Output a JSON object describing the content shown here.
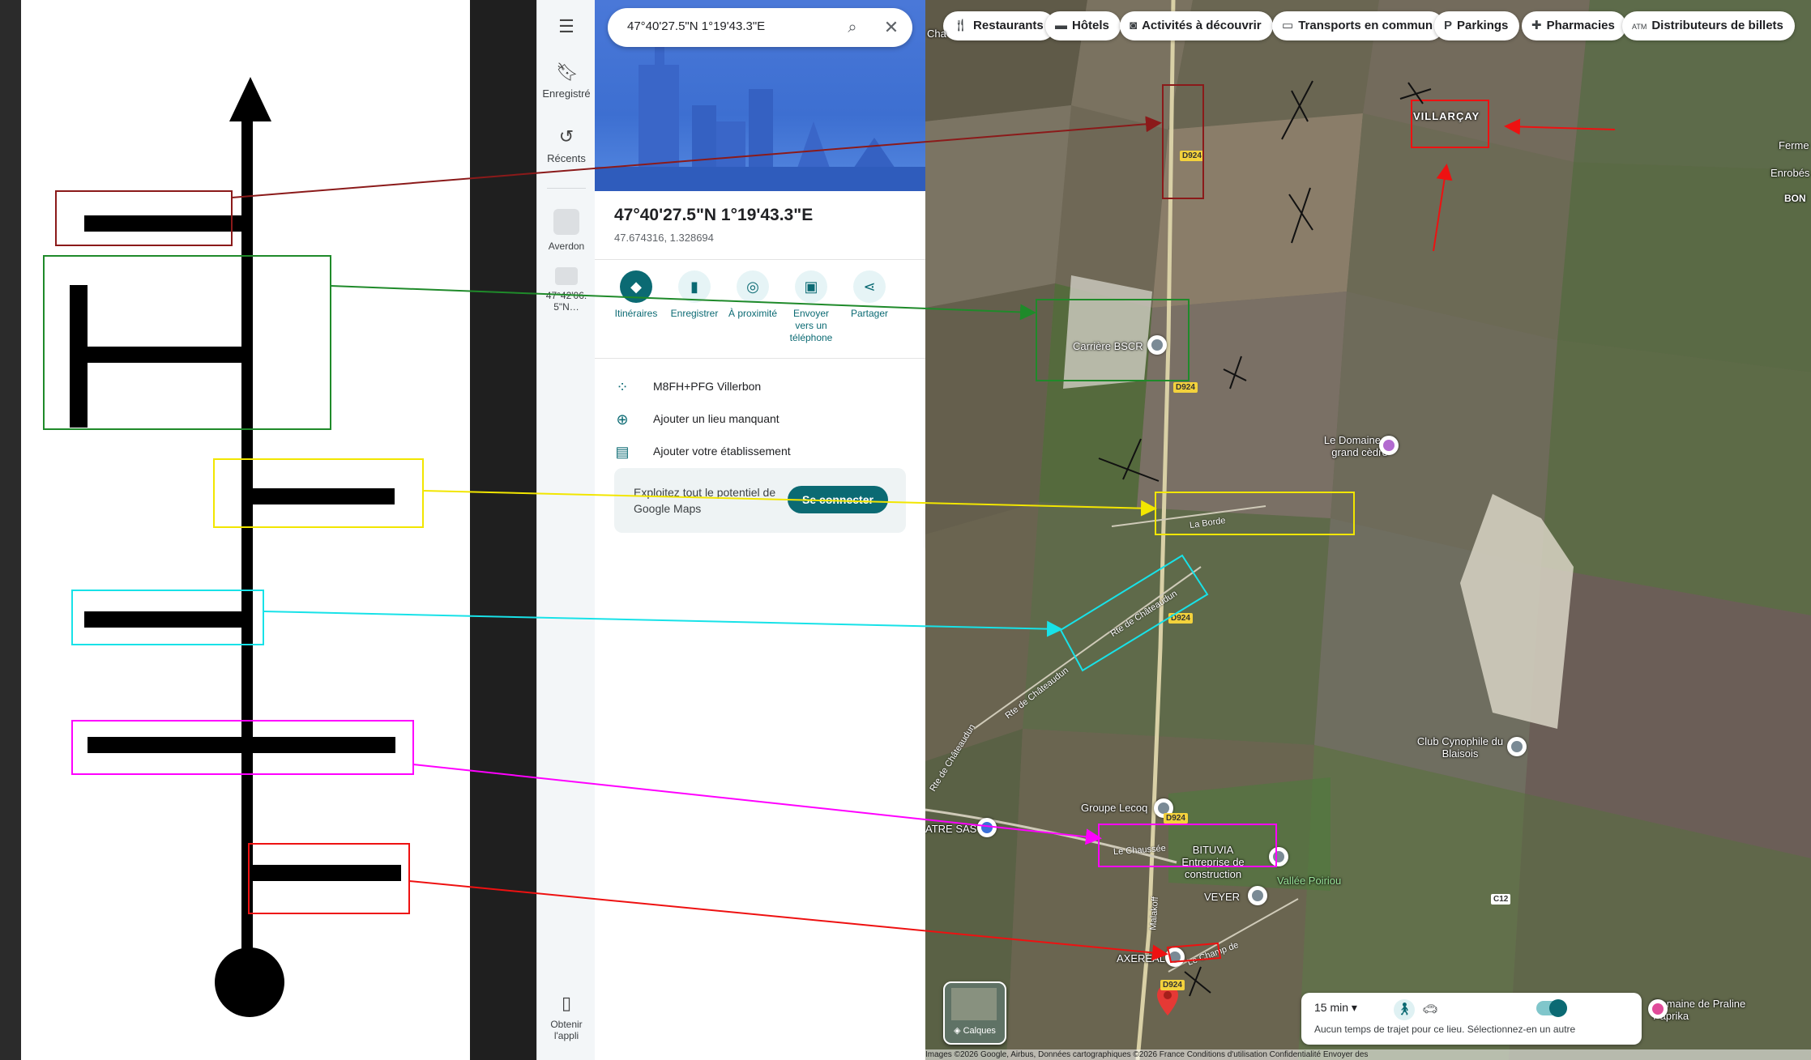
{
  "colors": {
    "maroon": "#8b1a1a",
    "green": "#1f8a2a",
    "yellow": "#f2e600",
    "cyan": "#18e2e8",
    "magenta": "#ff00ff",
    "red": "#ee1111",
    "accent": "#0b6a73"
  },
  "rail": {
    "menu_icon": "menu-icon",
    "saved": "Enregistré",
    "recents": "Récents",
    "history_1": "Averdon",
    "history_2": "47°42'06. 5\"N…",
    "get_app": "Obtenir l'appli"
  },
  "search": {
    "value": "47°40'27.5\"N 1°19'43.3\"E"
  },
  "place": {
    "title": "47°40'27.5\"N 1°19'43.3\"E",
    "coords": "47.674316, 1.328694"
  },
  "actions": [
    "Itinéraires",
    "Enregistrer",
    "À proximité",
    "Envoyer vers un téléphone",
    "Partager"
  ],
  "info": {
    "plus_code": "M8FH+PFG Villerbon",
    "add_place": "Ajouter un lieu manquant",
    "add_business": "Ajouter votre établissement"
  },
  "promo": {
    "text": "Exploitez tout le potentiel de Google Maps",
    "button": "Se connecter"
  },
  "chips": [
    "Restaurants",
    "Hôtels",
    "Activités à découvrir",
    "Transports en commun",
    "Parkings",
    "Pharmacies",
    "Distributeurs de billets"
  ],
  "map_labels": {
    "villarcay": "VILLARÇAY",
    "carriere": "Carrière BSCR",
    "domaine": "Le Domaine du grand cèdre",
    "club": "Club Cynophile du Blaisois",
    "lecoq": "Groupe Lecoq",
    "bituvia": "BITUVIA Entreprise de construction",
    "veyer": "VEYER",
    "vallee": "Vallée Poiriou",
    "axereal": "AXEREAL",
    "praline": "Domaine de Praline Paprika",
    "ferme": "Ferme",
    "enrobes": "Enrobés",
    "bon": "BON",
    "cha": "Cha",
    "atre": "ATRE SAS",
    "la_borde": "La Borde",
    "rte1": "Rte de Châteaudun",
    "rte2": "Rte de Châteaudun",
    "rte3": "Rte de Châteaudun",
    "chaussee": "Le Chaussée",
    "champ": "Le Champ de",
    "malakoff": "Malakoff",
    "d924": "D924",
    "c12": "C12"
  },
  "layers": {
    "label": "Calques"
  },
  "travel": {
    "time": "15 min",
    "message": "Aucun temps de trajet pour ce lieu. Sélectionnez-en un autre"
  },
  "attribution": "Images ©2026 Google, Airbus, Données cartographiques ©2026   France   Conditions d'utilisation   Confidentialité   Envoyer des"
}
